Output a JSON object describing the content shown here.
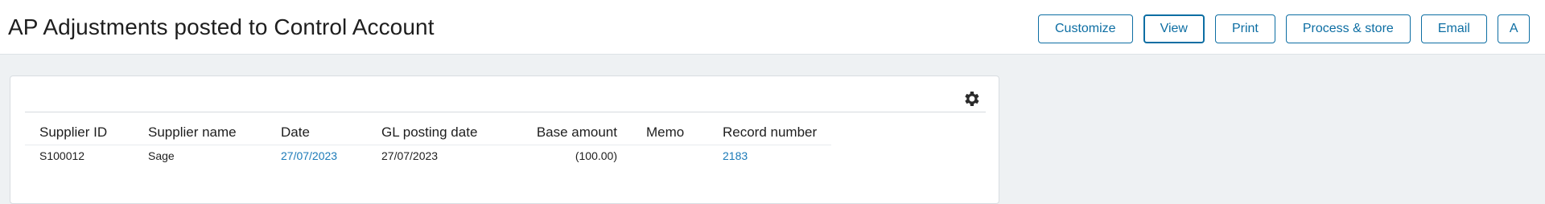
{
  "page": {
    "title": "AP Adjustments posted to Control Account"
  },
  "toolbar": {
    "buttons": [
      {
        "label": "Customize"
      },
      {
        "label": "View"
      },
      {
        "label": "Print"
      },
      {
        "label": "Process & store"
      },
      {
        "label": "Email"
      },
      {
        "label": "A"
      }
    ]
  },
  "report": {
    "settings_icon": "gear-icon",
    "columns": [
      "Supplier ID",
      "Supplier name",
      "Date",
      "GL posting date",
      "Base amount",
      "Memo",
      "Record number"
    ],
    "rows": [
      {
        "supplier_id": "S100012",
        "supplier_name": "Sage",
        "date": "27/07/2023",
        "gl_posting_date": "27/07/2023",
        "base_amount": "(100.00)",
        "memo": "",
        "record_number": "2183"
      }
    ]
  },
  "colors": {
    "accent": "#0d6ea3",
    "link": "#1b7ab8",
    "background": "#eef1f3"
  }
}
